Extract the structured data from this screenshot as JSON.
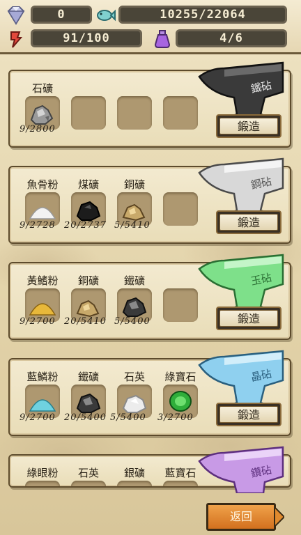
{
  "status": {
    "gems": "0",
    "fish": "10255/22064",
    "stamina": "91/100",
    "potions": "4/6"
  },
  "forge_label": "鍛造",
  "back_label": "返回",
  "recipes": [
    {
      "anvil": "鐵砧",
      "materials": [
        {
          "name": "石礦",
          "count": "9/2800",
          "icon": "stone-ore-icon"
        }
      ]
    },
    {
      "anvil": "鋼砧",
      "materials": [
        {
          "name": "魚骨粉",
          "count": "9/2728",
          "icon": "fishbone-powder-icon"
        },
        {
          "name": "煤礦",
          "count": "20/2737",
          "icon": "coal-ore-icon"
        },
        {
          "name": "銅礦",
          "count": "5/5410",
          "icon": "copper-ore-icon"
        }
      ]
    },
    {
      "anvil": "玉砧",
      "materials": [
        {
          "name": "黃鰭粉",
          "count": "9/2700",
          "icon": "yellowfin-powder-icon"
        },
        {
          "name": "銅礦",
          "count": "20/5410",
          "icon": "copper-ore-icon"
        },
        {
          "name": "鐵礦",
          "count": "5/5400",
          "icon": "iron-ore-icon"
        }
      ]
    },
    {
      "anvil": "晶砧",
      "materials": [
        {
          "name": "藍鱗粉",
          "count": "9/2700",
          "icon": "bluescale-powder-icon"
        },
        {
          "name": "鐵礦",
          "count": "20/5400",
          "icon": "iron-ore-icon"
        },
        {
          "name": "石英",
          "count": "5/5400",
          "icon": "quartz-icon"
        },
        {
          "name": "綠寶石",
          "count": "3/2700",
          "icon": "emerald-icon"
        }
      ]
    },
    {
      "anvil": "鑽砧",
      "materials": [
        {
          "name": "綠眼粉",
          "icon": "greeneye-powder-icon"
        },
        {
          "name": "石英",
          "icon": "quartz-icon"
        },
        {
          "name": "銀礦",
          "icon": "silver-ore-icon"
        },
        {
          "name": "藍寶石",
          "icon": "sapphire-icon"
        }
      ]
    }
  ],
  "colors": {
    "anvil_iron": "#3a3a3a",
    "anvil_steel": "#d8d8d8",
    "anvil_jade": "#7ee08a",
    "anvil_crystal": "#8fd0ef",
    "anvil_diamond": "#c89ae6"
  }
}
